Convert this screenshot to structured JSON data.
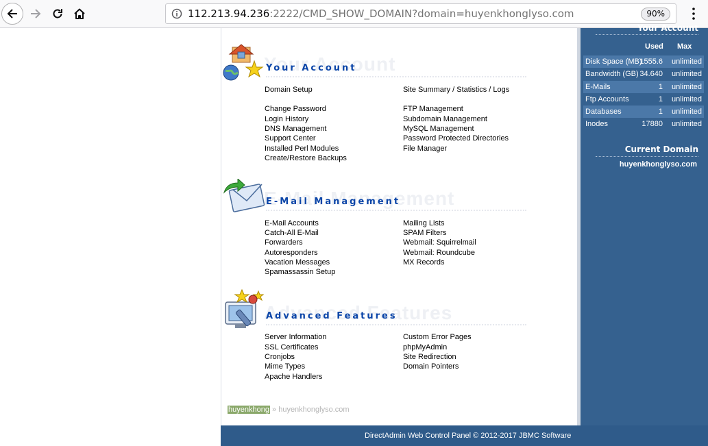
{
  "browser": {
    "url_host": "112.213.94.236",
    "url_rest": ":2222/CMD_SHOW_DOMAIN?domain=huyenkhonglyso.com",
    "zoom": "90%"
  },
  "sections": {
    "account": {
      "title": "Your Account",
      "ghost": "Your Account",
      "left": [
        "Domain Setup",
        "Change Password",
        "Login History",
        "DNS Management",
        "Support Center",
        "Installed Perl Modules",
        "Create/Restore Backups"
      ],
      "right": [
        "Site Summary / Statistics / Logs",
        "FTP Management",
        "Subdomain Management",
        "MySQL Management",
        "Password Protected Directories",
        "File Manager"
      ]
    },
    "email": {
      "title": "E-Mail Management",
      "ghost": "E-Mail Management",
      "left": [
        "E-Mail Accounts",
        "Catch-All E-Mail",
        "Forwarders",
        "Autoresponders",
        "Vacation Messages",
        "Spamassassin Setup"
      ],
      "right": [
        "Mailing Lists",
        "SPAM Filters",
        "Webmail: Squirrelmail",
        "Webmail: Roundcube",
        "MX Records"
      ]
    },
    "advanced": {
      "title": "Advanced Features",
      "ghost": "Advanced Features",
      "left": [
        "Server Information",
        "SSL Certificates",
        "Cronjobs",
        "Mime Types",
        "Apache Handlers"
      ],
      "right": [
        "Custom Error Pages",
        "phpMyAdmin",
        "Site Redirection",
        "Domain Pointers"
      ]
    }
  },
  "breadcrumb": {
    "user": "huyenkhong",
    "separator": "»",
    "domain": "huyenkhonglyso.com"
  },
  "footer": {
    "text": "DirectAdmin Web Control Panel © 2012-2017 JBMC Software"
  },
  "sidebar": {
    "account_title": "Your Account",
    "used_header": "Used",
    "max_header": "Max",
    "stats": [
      {
        "label": "Disk Space (MB)",
        "used": "1555.6",
        "max": "unlimited"
      },
      {
        "label": "Bandwidth (GB)",
        "used": "34.640",
        "max": "unlimited"
      },
      {
        "label": "E-Mails",
        "used": "1",
        "max": "unlimited"
      },
      {
        "label": "Ftp Accounts",
        "used": "1",
        "max": "unlimited"
      },
      {
        "label": "Databases",
        "used": "1",
        "max": "unlimited"
      },
      {
        "label": "Inodes",
        "used": "17880",
        "max": "unlimited"
      }
    ],
    "current_domain_title": "Current Domain",
    "current_domain": "huyenkhonglyso.com"
  },
  "colors": {
    "section_title": "#0b45a8",
    "sidebar_bg": "#35618f",
    "sidebar_alt_row": "#4b78a8",
    "footer_bg": "#2f5b8a"
  }
}
